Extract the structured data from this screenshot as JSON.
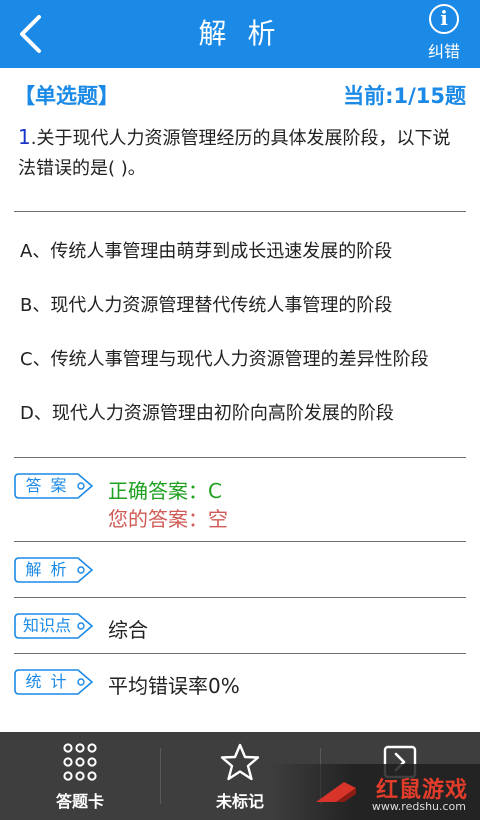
{
  "header": {
    "title": "解 析",
    "report_label": "纠错",
    "report_icon": "info-icon"
  },
  "question": {
    "type_label": "【单选题】",
    "progress": "当前:1/15题",
    "number": "1",
    "text": ".关于现代人力资源管理经历的具体发展阶段，以下说法错误的是( )。"
  },
  "options": [
    {
      "label": "A、传统人事管理由萌芽到成长迅速发展的阶段"
    },
    {
      "label": "B、现代人力资源管理替代传统人事管理的阶段"
    },
    {
      "label": "C、传统人事管理与现代人力资源管理的差异性阶段"
    },
    {
      "label": "D、现代人力资源管理由初阶向高阶发展的阶段"
    }
  ],
  "answer": {
    "tag": "答 案",
    "correct": "正确答案：C",
    "yours": "您的答案：空"
  },
  "analysis": {
    "tag": "解 析",
    "value": ""
  },
  "knowledge": {
    "tag": "知识点",
    "value": "综合"
  },
  "stats": {
    "tag": "统 计",
    "value": "平均错误率0%"
  },
  "bottom": {
    "tabs": [
      {
        "label": "答题卡",
        "icon": "grid-dots-icon"
      },
      {
        "label": "未标记",
        "icon": "star-outline-icon"
      },
      {
        "label": "",
        "icon": "next-arrow-icon"
      }
    ]
  },
  "watermark": {
    "brand": "红鼠游戏",
    "url": "www.redshu.com"
  },
  "colors": {
    "header_bg": "#1b8ae6",
    "accent": "#1b8ae6",
    "correct": "#20a020",
    "yours": "#d05a55",
    "bottom_bg": "#3e3e3e"
  }
}
